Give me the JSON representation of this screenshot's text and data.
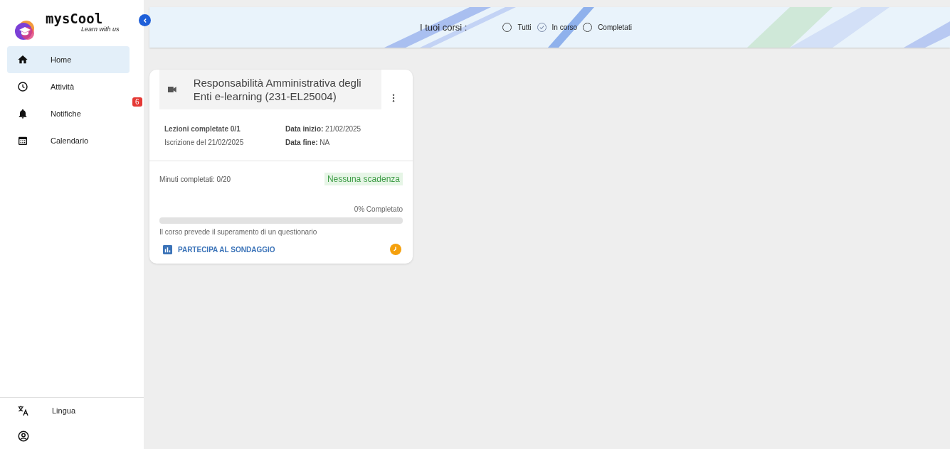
{
  "brand": {
    "name": "mysCool",
    "tagline": "Learn with us"
  },
  "sidebar": {
    "items": [
      {
        "label": "Home",
        "kind": "home",
        "selected": true
      },
      {
        "label": "Attività",
        "kind": "clock",
        "selected": false
      },
      {
        "label": "Notifiche",
        "kind": "bell",
        "selected": false,
        "badge": "6"
      },
      {
        "label": "Calendario",
        "kind": "calendar",
        "selected": false
      }
    ],
    "bottom_items": [
      {
        "label": "Lingua",
        "kind": "translate"
      },
      {
        "kind": "account"
      }
    ]
  },
  "filter": {
    "label": "I tuoi corsi :",
    "options": [
      {
        "label": "Tutti",
        "selected": false
      },
      {
        "label": "In corso",
        "selected": true
      },
      {
        "label": "Completati",
        "selected": false
      }
    ]
  },
  "courses": [
    {
      "title": "Responsabilità Amministrativa degli Enti e-learning (231-EL25004)",
      "lessons": "Lezioni completate 0/1",
      "enrollment": "Iscrizione del 21/02/2025",
      "start": "**Data inizio:** 21/02/2025",
      "end": "**Data fine:** NA",
      "minutes": "Minuti completati: 0/20",
      "deadline": "Nessuna scadenza",
      "progress_text": "0% Completato",
      "level": 0,
      "note": "Il corso prevede il superamento di un questionario",
      "survey": "PARTECIPA AL SONDAGGIO"
    }
  ]
}
